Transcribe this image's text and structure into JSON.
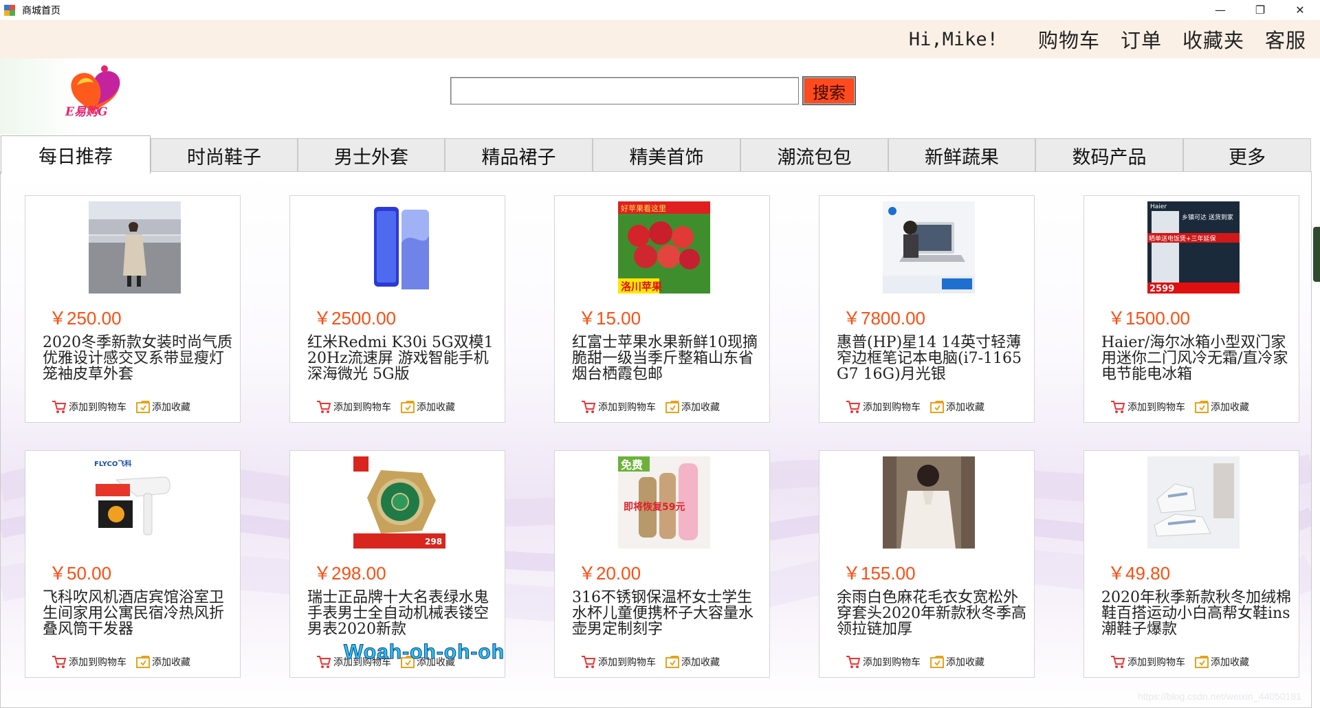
{
  "window": {
    "title": "商城首页",
    "min": "—",
    "restore": "❐",
    "close": "✕"
  },
  "header": {
    "greeting": "Hi,Mike!",
    "links": [
      "购物车",
      "订单",
      "收藏夹",
      "客服"
    ]
  },
  "logo": {
    "text": "E易购G"
  },
  "search": {
    "value": "",
    "placeholder": "",
    "button": "搜索"
  },
  "tabs": [
    "每日推荐",
    "时尚鞋子",
    "男士外套",
    "精品裙子",
    "精美首饰",
    "潮流包包",
    "新鲜蔬果",
    "数码产品",
    "更多"
  ],
  "active_tab": "每日推荐",
  "actions": {
    "cart": "添加到购物车",
    "fav": "添加收藏"
  },
  "products": [
    {
      "price": "￥250.00",
      "title": "2020冬季新款女装时尚气质优雅设计感交叉系带显瘦灯笼袖皮草外套",
      "img": "coat-photo"
    },
    {
      "price": "￥2500.00",
      "title": "红米Redmi K30i 5G双模120Hz流速屏 游戏智能手机 深海微光 5G版",
      "img": "phone-photo"
    },
    {
      "price": "￥15.00",
      "title": "红富士苹果水果新鲜10现摘脆甜一级当季斤整箱山东省烟台栖霞包邮",
      "img": "apple-photo"
    },
    {
      "price": "￥7800.00",
      "title": "惠普(HP)星14 14英寸轻薄窄边框笔记本电脑(i7-1165G7 16G)月光银",
      "img": "laptop-photo"
    },
    {
      "price": "￥1500.00",
      "title": "Haier/海尔冰箱小型双门家用迷你二门风冷无霜/直冷家电节能电冰箱",
      "img": "fridge-photo"
    },
    {
      "price": "￥50.00",
      "title": "飞科吹风机酒店宾馆浴室卫生间家用公寓民宿冷热风折叠风筒干发器",
      "img": "hairdryer-photo"
    },
    {
      "price": "￥298.00",
      "title": "瑞士正品牌十大名表绿水鬼手表男士全自动机械表镂空男表2020新款",
      "img": "watch-photo"
    },
    {
      "price": "￥20.00",
      "title": "316不锈钢保温杯女士学生水杯儿童便携杯子大容量水壶男定制刻字",
      "img": "thermos-photo"
    },
    {
      "price": "￥155.00",
      "title": "余雨白色麻花毛衣女宽松外穿套头2020年新款秋冬季高领拉链加厚",
      "img": "sweater-photo"
    },
    {
      "price": "￥49.80",
      "title": "2020年秋季新款秋冬加绒棉鞋百搭运动小白高帮女鞋ins潮鞋子爆款",
      "img": "sneaker-photo"
    }
  ],
  "thumb_text": {
    "apple_banner": "好苹果看这里",
    "apple_tag": "洛川苹果",
    "fridge_brand": "Haier",
    "fridge_slogan": "乡镇可达 送货到家",
    "fridge_offer": "晒单送电饭煲+三年延保",
    "fridge_price": "2599",
    "dryer_brand": "FLYCO飞科",
    "watch_price": "298",
    "thermos_free": "免费",
    "thermos_tag": "即将恢复59元"
  },
  "overlay": "Woah-oh-oh-oh",
  "watermark": "https://blog.csdn.net/weixin_44050181"
}
